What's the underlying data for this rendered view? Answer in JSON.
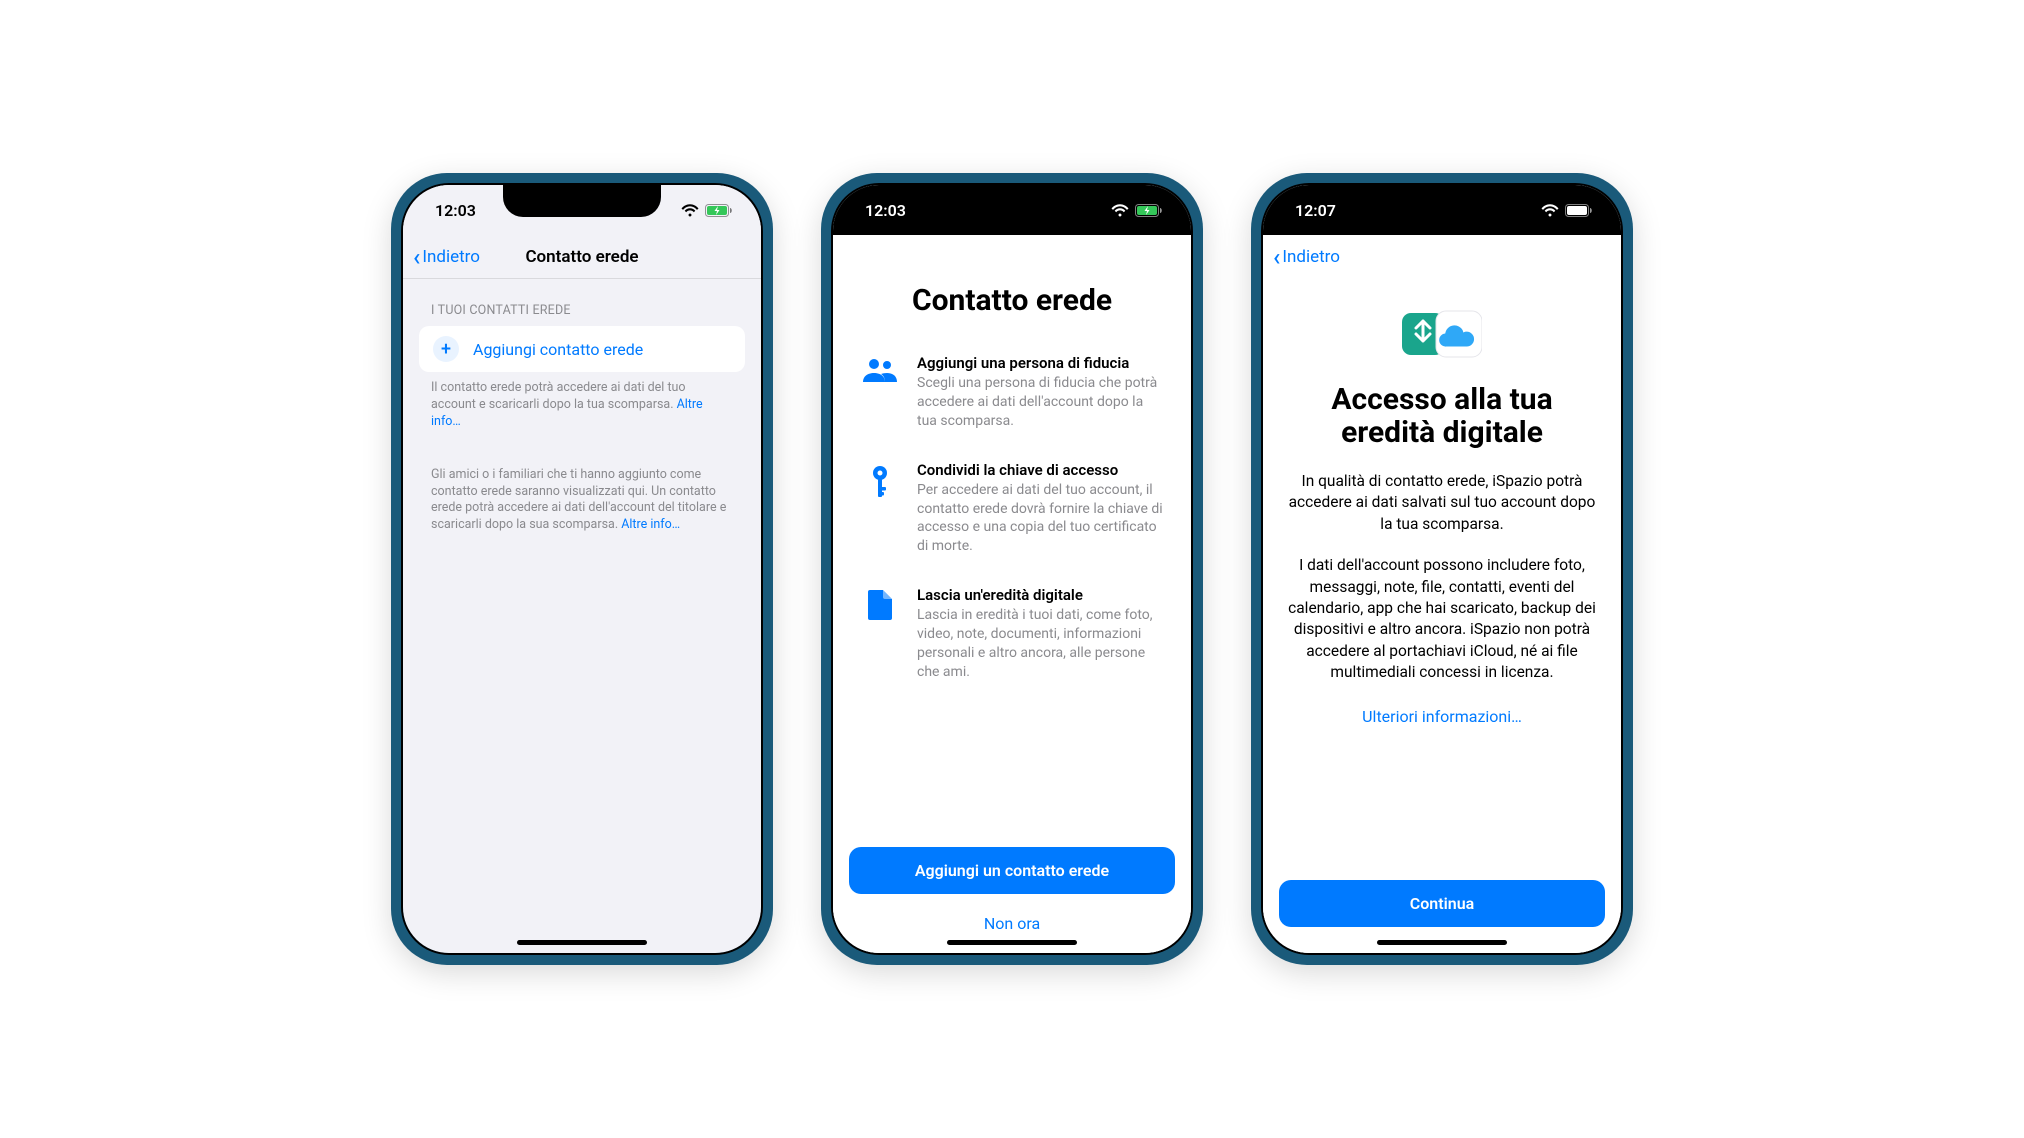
{
  "phone1": {
    "time": "12:03",
    "back": "Indietro",
    "title": "Contatto erede",
    "section_header": "I TUOI CONTATTI EREDE",
    "add_label": "Aggiungi contatto erede",
    "footer1_text": "Il contatto erede potrà accedere ai dati del tuo account e scaricarli dopo la tua scomparsa. ",
    "footer1_link": "Altre info…",
    "footer2_text": "Gli amici o i familiari che ti hanno aggiunto come contatto erede saranno visualizzati qui. Un contatto erede potrà accedere ai dati dell'account del titolare e scaricarli dopo la sua scomparsa. ",
    "footer2_link": "Altre info…"
  },
  "phone2": {
    "time": "12:03",
    "title": "Contatto erede",
    "items": [
      {
        "heading": "Aggiungi una persona di fiducia",
        "body": "Scegli una persona di fiducia che potrà accedere ai dati dell'account dopo la tua scomparsa."
      },
      {
        "heading": "Condividi la chiave di accesso",
        "body": "Per accedere ai dati del tuo account, il contatto erede dovrà fornire la chiave di accesso e una copia del tuo certificato di morte."
      },
      {
        "heading": "Lascia un'eredità digitale",
        "body": "Lascia in eredità i tuoi dati, come foto, video, note, documenti, informazioni personali e altro ancora, alle persone che ami."
      }
    ],
    "primary": "Aggiungi un contatto erede",
    "secondary": "Non ora"
  },
  "phone3": {
    "time": "12:07",
    "back": "Indietro",
    "title_line1": "Accesso alla tua",
    "title_line2": "eredità digitale",
    "para1": "In qualità di contatto erede, iSpazio potrà accedere ai dati salvati sul tuo account dopo la tua scomparsa.",
    "para2": "I dati dell'account possono includere foto, messaggi, note, file, contatti, eventi del calendario, app che hai scaricato, backup dei dispositivi e altro ancora. iSpazio non potrà accedere al portachiavi iCloud, né ai file multimediali concessi in licenza.",
    "more_link": "Ulteriori informazioni…",
    "primary": "Continua"
  }
}
